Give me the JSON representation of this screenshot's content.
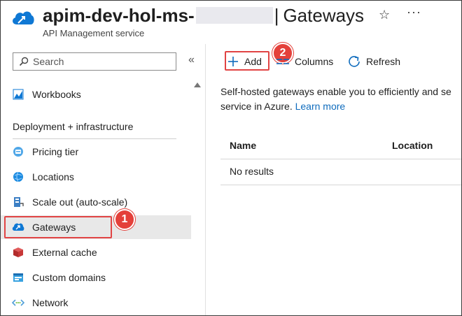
{
  "header": {
    "title_prefix": "apim-dev-hol-ms-",
    "separator": "|",
    "page_title": "Gateways",
    "subtitle": "API Management service",
    "favorite_icon": "star-icon",
    "more_icon": "ellipsis-icon"
  },
  "sidebar": {
    "search_placeholder": "Search",
    "collapse_label": "«",
    "items_top": [
      {
        "label": "Workbooks",
        "icon": "workbooks-icon"
      }
    ],
    "section_heading": "Deployment + infrastructure",
    "items": [
      {
        "label": "Pricing tier",
        "icon": "pricing-tier-icon"
      },
      {
        "label": "Locations",
        "icon": "locations-icon"
      },
      {
        "label": "Scale out (auto-scale)",
        "icon": "scale-out-icon"
      },
      {
        "label": "Gateways",
        "icon": "gateways-icon",
        "selected": true
      },
      {
        "label": "External cache",
        "icon": "external-cache-icon"
      },
      {
        "label": "Custom domains",
        "icon": "custom-domains-icon"
      },
      {
        "label": "Network",
        "icon": "network-icon"
      }
    ]
  },
  "toolbar": {
    "add_label": "Add",
    "columns_label": "Columns",
    "refresh_label": "Refresh"
  },
  "annotations": {
    "badge_1": "1",
    "badge_2": "2"
  },
  "main": {
    "description": "Self-hosted gateways enable you to efficiently and se",
    "description_line2": "service in Azure.",
    "learn_more": "Learn more",
    "table": {
      "columns": [
        "Name",
        "Location"
      ],
      "empty_text": "No results"
    }
  },
  "colors": {
    "accent": "#0f6cbd",
    "highlight": "#e14444",
    "selected_bg": "#e8e8e8"
  }
}
